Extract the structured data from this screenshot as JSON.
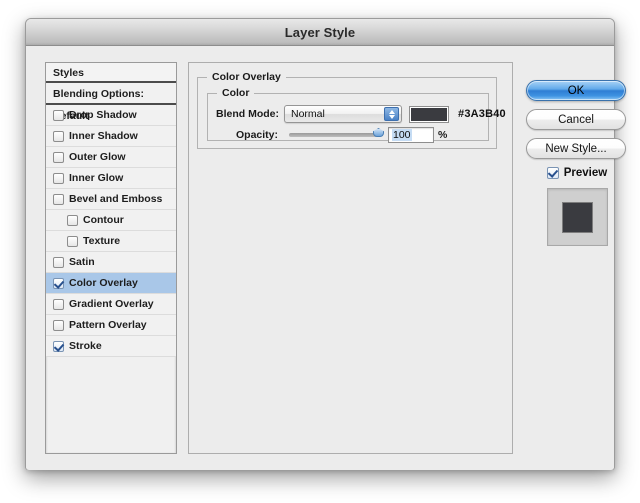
{
  "window": {
    "title": "Layer Style"
  },
  "sidebar": {
    "header": "Styles",
    "blending_options": "Blending Options: Default",
    "items": [
      {
        "label": "Drop Shadow",
        "checked": false,
        "indent": false,
        "selected": false
      },
      {
        "label": "Inner Shadow",
        "checked": false,
        "indent": false,
        "selected": false
      },
      {
        "label": "Outer Glow",
        "checked": false,
        "indent": false,
        "selected": false
      },
      {
        "label": "Inner Glow",
        "checked": false,
        "indent": false,
        "selected": false
      },
      {
        "label": "Bevel and Emboss",
        "checked": false,
        "indent": false,
        "selected": false
      },
      {
        "label": "Contour",
        "checked": false,
        "indent": true,
        "selected": false
      },
      {
        "label": "Texture",
        "checked": false,
        "indent": true,
        "selected": false
      },
      {
        "label": "Satin",
        "checked": false,
        "indent": false,
        "selected": false
      },
      {
        "label": "Color Overlay",
        "checked": true,
        "indent": false,
        "selected": true
      },
      {
        "label": "Gradient Overlay",
        "checked": false,
        "indent": false,
        "selected": false
      },
      {
        "label": "Pattern Overlay",
        "checked": false,
        "indent": false,
        "selected": false
      },
      {
        "label": "Stroke",
        "checked": true,
        "indent": false,
        "selected": false
      }
    ]
  },
  "main": {
    "group_title": "Color Overlay",
    "color_group_title": "Color",
    "blend_mode": {
      "label": "Blend Mode:",
      "value": "Normal"
    },
    "color": {
      "swatch_hex": "#3A3B40",
      "hex_label": "#3A3B40"
    },
    "opacity": {
      "label": "Opacity:",
      "value": "100",
      "unit": "%",
      "percent": 100
    }
  },
  "buttons": {
    "ok": "OK",
    "cancel": "Cancel",
    "new_style": "New Style...",
    "preview_label": "Preview",
    "preview_checked": true
  },
  "preview_thumbnail": {
    "background_hex": "#CFCFCF",
    "shape_hex": "#3A3B40"
  }
}
